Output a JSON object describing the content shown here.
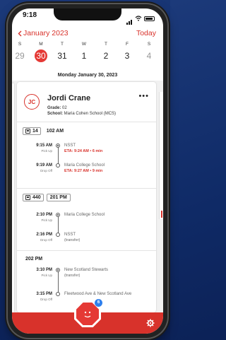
{
  "status": {
    "time": "9:18"
  },
  "header": {
    "month": "January 2023",
    "today": "Today"
  },
  "week": [
    {
      "dow": "S",
      "num": "29",
      "muted": true
    },
    {
      "dow": "M",
      "num": "30",
      "selected": true
    },
    {
      "dow": "T",
      "num": "31"
    },
    {
      "dow": "W",
      "num": "1"
    },
    {
      "dow": "T",
      "num": "2"
    },
    {
      "dow": "F",
      "num": "3"
    },
    {
      "dow": "S",
      "num": "4",
      "muted": true
    }
  ],
  "selected_date": "Monday January 30, 2023",
  "student": {
    "initials": "JC",
    "name": "Jordi Crane",
    "grade_label": "Grade:",
    "grade": "02",
    "school_label": "School:",
    "school": "Maria Cohen School (MCS)"
  },
  "routes": [
    {
      "bus": "14",
      "time": "102 AM",
      "stops": [
        {
          "time": "9:15 AM",
          "label": "Pick Up",
          "place": "NSST",
          "eta": "ETA: 9:24 AM • 6 min",
          "filled": true
        },
        {
          "time": "9:19 AM",
          "label": "Drop Off",
          "place": "Maria College School",
          "eta": "ETA: 9:27 AM • 9 min",
          "filled": false
        }
      ]
    },
    {
      "bus": "440",
      "time": "201 PM",
      "stops": [
        {
          "time": "2:10 PM",
          "label": "Pick Up",
          "place": "Maria College School",
          "filled": true
        },
        {
          "time": "2:16 PM",
          "label": "Drop Off",
          "place": "NSST",
          "sub": "(transfer)",
          "filled": false
        }
      ]
    },
    {
      "time": "202 PM",
      "stops": [
        {
          "time": "3:10 PM",
          "label": "Pick Up",
          "place": "New Scotland Stewarts",
          "sub": "(transfer)",
          "filled": true
        },
        {
          "time": "3:15 PM",
          "label": "Drop Off",
          "place": "Fleetwood Ave & New Scotland Ave",
          "filled": false
        }
      ]
    }
  ],
  "footer": {
    "badge_count": "6"
  },
  "colors": {
    "accent": "#d8322b",
    "eta": "#d8322b",
    "badge": "#2f80ed"
  },
  "icons": [
    "chevron-left-icon",
    "bus-icon",
    "stop-sign-icon",
    "gear-icon",
    "more-icon"
  ]
}
